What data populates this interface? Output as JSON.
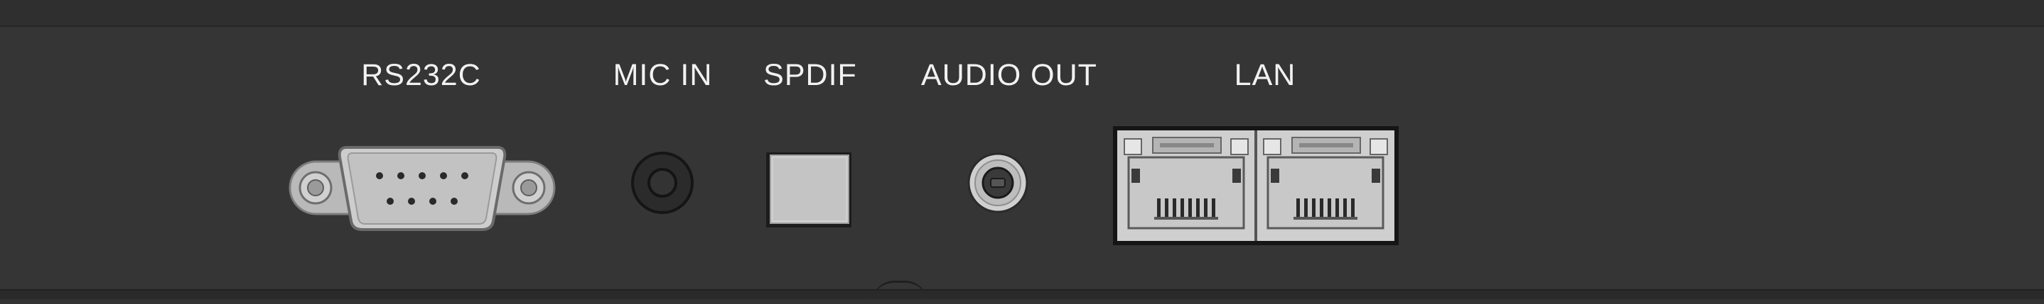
{
  "labels": {
    "rs232c": "RS232C",
    "mic_in": "MIC IN",
    "spdif": "SPDIF",
    "audio_out": "AUDIO OUT",
    "lan": "LAN"
  },
  "colors": {
    "panel": "#353535",
    "label_text": "#f2f2f2",
    "metal": "#c9c9c9",
    "port_dark": "#1a1a1a"
  },
  "icons": {
    "rs232c": "db9-serial-connector-icon",
    "mic_in": "mic-jack-icon",
    "spdif": "optical-port-icon",
    "audio_out": "audio-jack-icon",
    "lan": "rj45-dual-port-icon"
  }
}
